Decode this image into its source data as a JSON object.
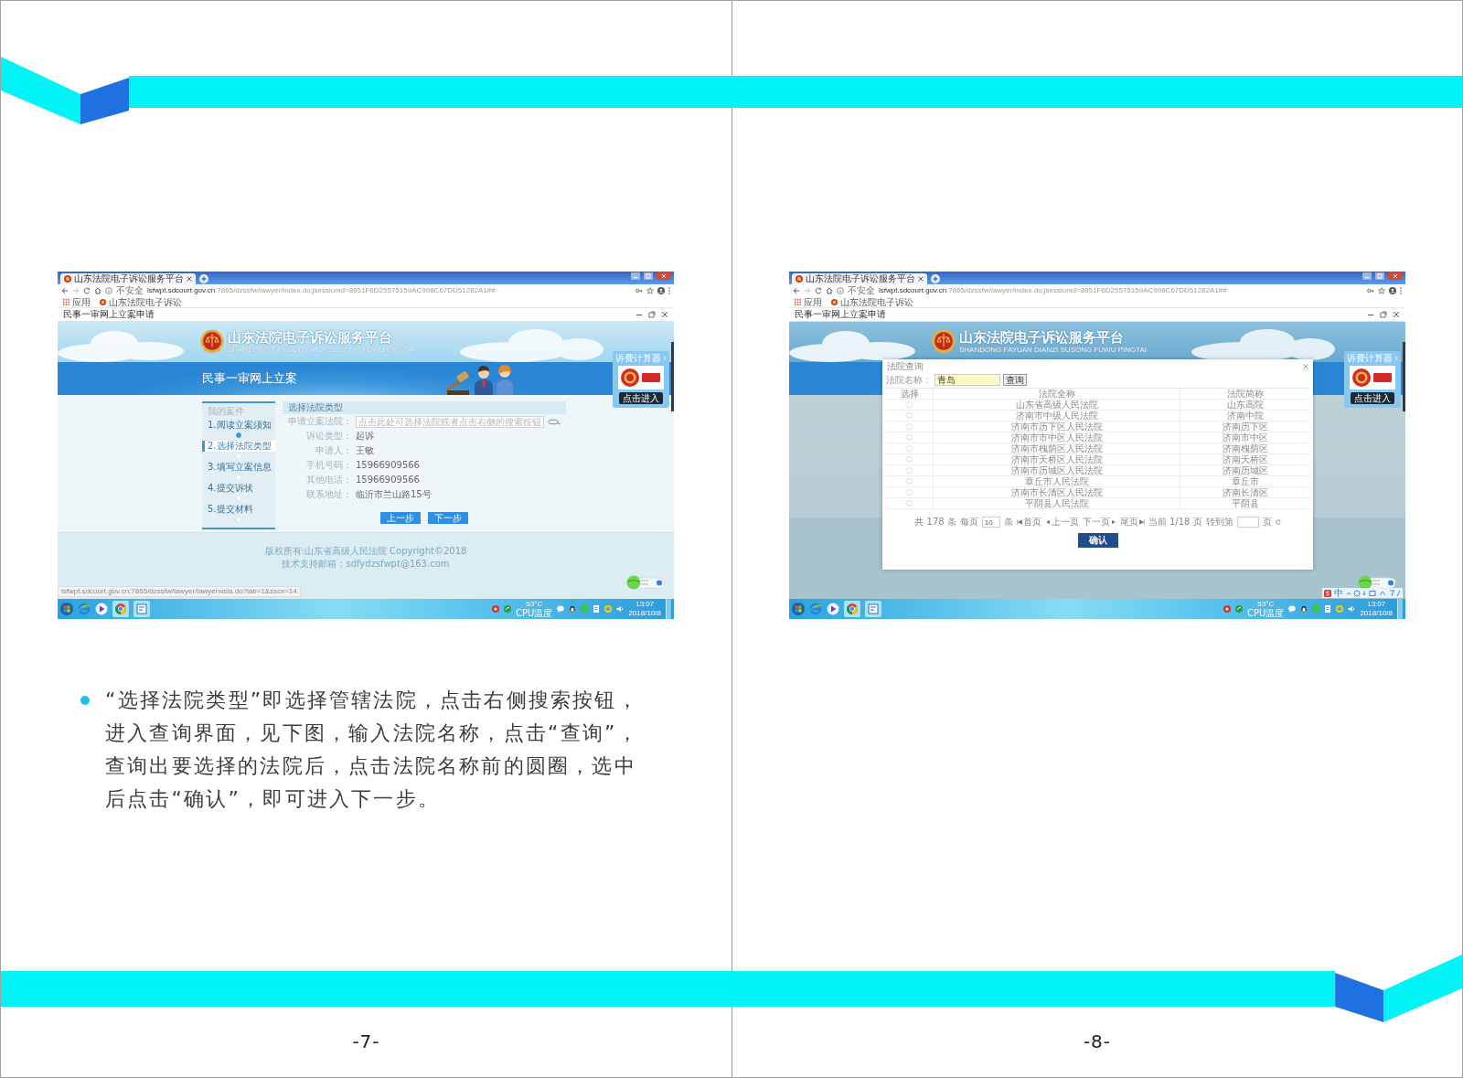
{
  "pages": [
    {
      "number": "-7-",
      "screenshot": {
        "browser": {
          "tab_title": "山东法院电子诉讼服务平台",
          "security": "不安全",
          "url_host": "lsfwpt.sdcourt.gov.cn",
          "url_path": ":7865/dzssfw/lawyer/index.do;jsessionid=8951F6D25575159AC998C67DD51282A1##",
          "bookmarks": [
            "应用",
            "山东法院电子诉讼"
          ]
        },
        "window_title": "民事一审网上立案申请",
        "site": {
          "title": "山东法院电子诉讼服务平台",
          "subtitle": "SHANDONG FAYUAN DIANZI SUSONG FUWU PINGTAI"
        },
        "banner_title": "民事一审网上立案",
        "side_widget": {
          "title": "诉费计算器",
          "button": "点击进入"
        },
        "sidebar": {
          "heading": "我的案件",
          "steps": [
            {
              "label": "1.阅读立案须知",
              "selected": false,
              "done": true
            },
            {
              "label": "2.选择法院类型",
              "selected": true,
              "done": false
            },
            {
              "label": "3.填写立案信息",
              "selected": false,
              "done": false
            },
            {
              "label": "4.提交诉状",
              "selected": false,
              "done": false
            },
            {
              "label": "5.提交材料",
              "selected": false,
              "done": false
            }
          ]
        },
        "form": {
          "title": "选择法院类型",
          "fields": [
            {
              "kind": "input",
              "label": "申请立案法院：",
              "placeholder": "点击此处可选择法院或者点击右侧的搜索按钮"
            },
            {
              "kind": "text",
              "label": "诉讼类型：",
              "value": "起诉"
            },
            {
              "kind": "text",
              "label": "申请人：",
              "value": "王敏"
            },
            {
              "kind": "text",
              "label": "手机号码：",
              "value": "15966909566"
            },
            {
              "kind": "text",
              "label": "其他电话：",
              "value": "15966909566"
            },
            {
              "kind": "text",
              "label": "联系地址：",
              "value": "临沂市兰山路15号"
            }
          ],
          "buttons": [
            "上一步",
            "下一步"
          ]
        },
        "footer": [
          "版权所有:山东省高级人民法院 Copyright©2018",
          "技术支持邮箱：sdfydzsfwpt@163.com"
        ],
        "status_url": "lsfwpt.sdcourt.gov.cn:7865/dzssfw/lawyer/lawyerwsla.do?lab=1&sscx=14",
        "taskbar": {
          "temperature": "53°C",
          "temperature_label": "CPU温度",
          "time": "13:07",
          "date": "2018/10/8"
        }
      },
      "paragraph": "“选择法院类型”即选择管辖法院，点击右侧搜索按钮，进入查询界面，见下图，输入法院名称，点击“查询”，查询出要选择的法院后，点击法院名称前的圆圈，选中后点击“确认”，即可进入下一步。"
    },
    {
      "number": "-8-",
      "screenshot": {
        "browser": {
          "tab_title": "山东法院电子诉讼服务平台",
          "security": "不安全",
          "url_host": "lsfwpt.sdcourt.gov.cn",
          "url_path": ":7865/dzssfw/lawyer/index.do;jsessionid=8951F6D25575159AC998C67DD51282A1##",
          "bookmarks": [
            "应用",
            "山东法院电子诉讼"
          ]
        },
        "window_title": "民事一审网上立案申请",
        "site": {
          "title": "山东法院电子诉讼服务平台",
          "subtitle": "SHANDONG FAYUAN DIANZI SUSONG FUWU PINGTAI"
        },
        "side_widget": {
          "title": "诉费计算器",
          "button": "点击进入"
        },
        "dialog": {
          "title": "法院查询",
          "search_label": "法院名称：",
          "search_value": "青岛",
          "search_button": "查询",
          "columns": [
            "选择",
            "法院全称",
            "法院简称"
          ],
          "rows": [
            {
              "name": "山东省高级人民法院",
              "short": "山东高院",
              "selected": false
            },
            {
              "name": "济南市中级人民法院",
              "short": "济南中院",
              "selected": false
            },
            {
              "name": "济南市历下区人民法院",
              "short": "济南历下区",
              "selected": false
            },
            {
              "name": "济南市市中区人民法院",
              "short": "济南市中区",
              "selected": false
            },
            {
              "name": "济南市槐荫区人民法院",
              "short": "济南槐荫区",
              "selected": false
            },
            {
              "name": "济南市天桥区人民法院",
              "short": "济南天桥区",
              "selected": false
            },
            {
              "name": "济南市历城区人民法院",
              "short": "济南历城区",
              "selected": false
            },
            {
              "name": "章丘市人民法院",
              "short": "章丘市",
              "selected": false
            },
            {
              "name": "济南市长清区人民法院",
              "short": "济南长清区",
              "selected": false
            },
            {
              "name": "平阴县人民法院",
              "short": "平阴县",
              "selected": false
            }
          ],
          "pagination": {
            "total": "共 178 条",
            "per_page_label": "每页",
            "per_page": "10",
            "per_page_unit": "条",
            "first": "首页",
            "prev": "上一页",
            "next": "下一页",
            "last": "尾页",
            "current": "当前 1/18 页",
            "jump_label": "转到第",
            "jump_unit": "页"
          },
          "confirm": "确认"
        },
        "ime": {
          "mode": "中"
        },
        "taskbar": {
          "temperature": "53°C",
          "temperature_label": "CPU温度",
          "time": "13:07",
          "date": "2018/10/8"
        }
      }
    }
  ]
}
